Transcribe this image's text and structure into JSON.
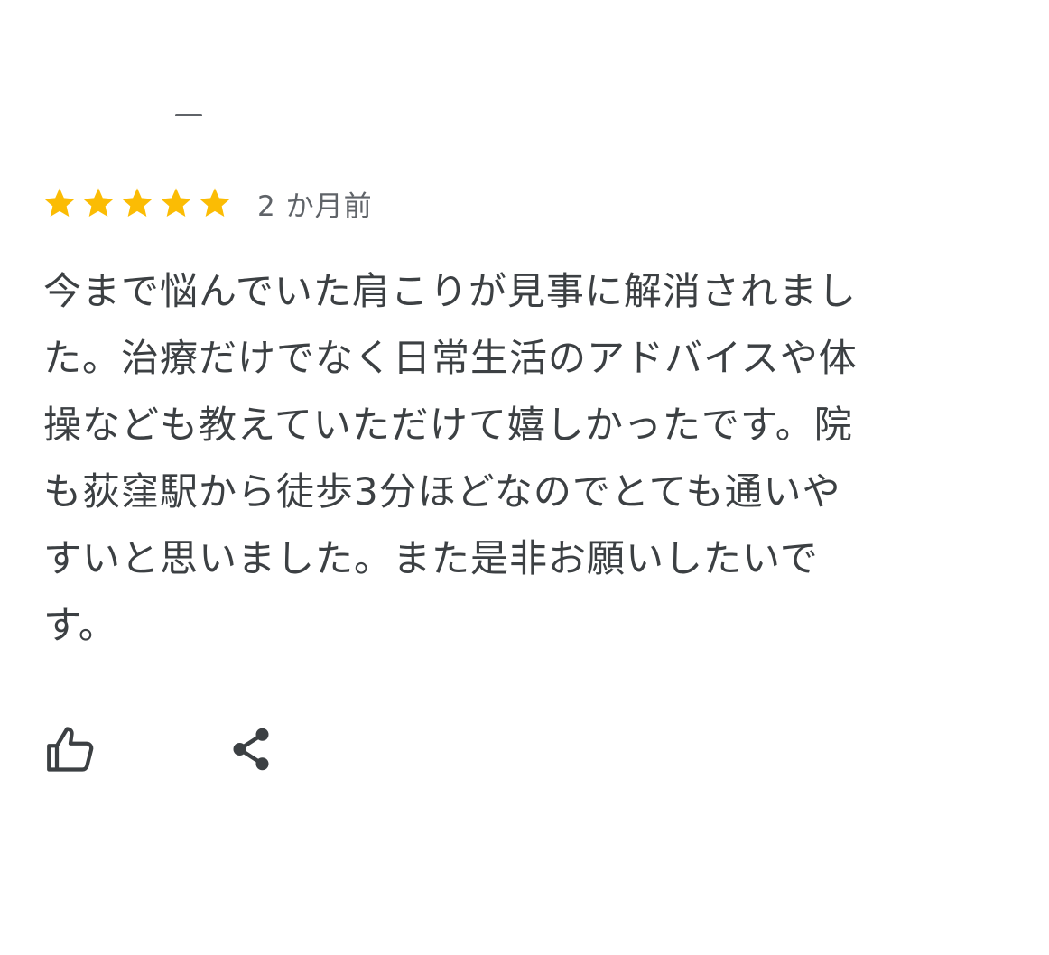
{
  "review": {
    "rating": 5,
    "max_rating": 5,
    "star_color": "#fbbc04",
    "time_ago": "2 か月前",
    "text": "今まで悩んでいた肩こりが見事に解消されまし\nた。治療だけでなく日常生活のアドバイスや体\n操なども教えていただけて嬉しかったです。院\nも荻窪駅から徒歩3分ほどなのでとても通いや\nすいと思いました。また是非お願いしたいで\nす。"
  },
  "actions": {
    "like_icon": "thumbs-up-icon",
    "share_icon": "share-icon"
  }
}
